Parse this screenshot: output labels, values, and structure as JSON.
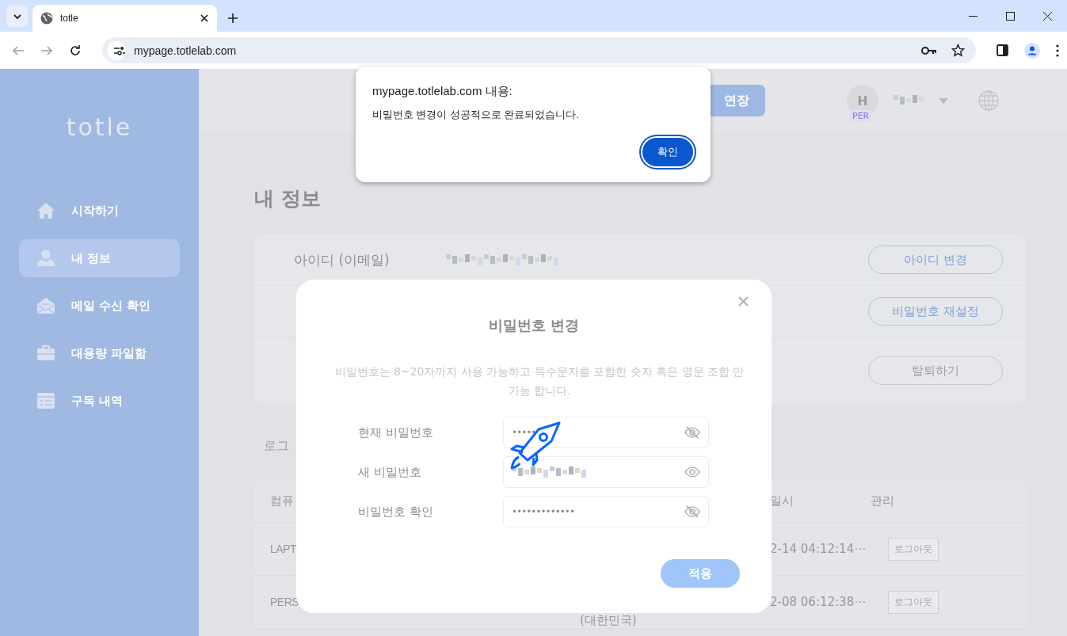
{
  "browser": {
    "tab": {
      "title": "totle",
      "selected": true
    },
    "address": "mypage.totlelab.com"
  },
  "sidebar": {
    "logo": "totle",
    "items": [
      {
        "label": "시작하기",
        "selected": false
      },
      {
        "label": "내 정보",
        "selected": true
      },
      {
        "label": "메일 수신 확인",
        "selected": false
      },
      {
        "label": "대용량 파일함",
        "selected": false
      },
      {
        "label": "구독 내역",
        "selected": false
      }
    ]
  },
  "header": {
    "subscribe_button": "연장",
    "avatar": {
      "initial": "H",
      "badge": "PER"
    },
    "user_name": {
      "redacted": true
    }
  },
  "page": {
    "title": "내 정보",
    "account_rows": [
      {
        "label": "아이디 (이메일)",
        "value": {
          "redacted": true
        },
        "button": "아이디 변경",
        "kind": "primary"
      },
      {
        "button": "비밀번호 재설정",
        "kind": "primary"
      },
      {
        "button": "탈퇴하기",
        "kind": "neutral"
      }
    ],
    "login_section": {
      "title": "로그",
      "columns": {
        "column_1": "컴퓨",
        "column_3": "일시",
        "column_4": "관리"
      },
      "rows": [
        {
          "column_1": "LAPT",
          "column_3": "2-14 04:12:14⋯",
          "button": "로그아웃"
        },
        {
          "column_1": "PERS",
          "column_2": "(대한민국)",
          "column_3": "2-08 06:12:38⋯",
          "button": "로그아웃"
        }
      ]
    }
  },
  "modal": {
    "title": "비밀번호 변경",
    "description": "비밀번호는 8~20자까지 사용 가능하고 특수문자를 포함한 숫자 혹은 영문 조합 만 가능 합니다.",
    "fields": [
      {
        "label": "현재 비밀번호",
        "value": "•••••",
        "masked": true
      },
      {
        "label": "새 비밀번호",
        "redacted": true,
        "masked": false
      },
      {
        "label": "비밀번호 확인",
        "value": "•••••••••••••",
        "masked": true
      }
    ],
    "apply_button": "적용"
  },
  "alert": {
    "title": "mypage.totlelab.com 내용:",
    "message": "비밀번호 변경이 성공적으로 완료되었습니다.",
    "ok_button": "확인"
  }
}
